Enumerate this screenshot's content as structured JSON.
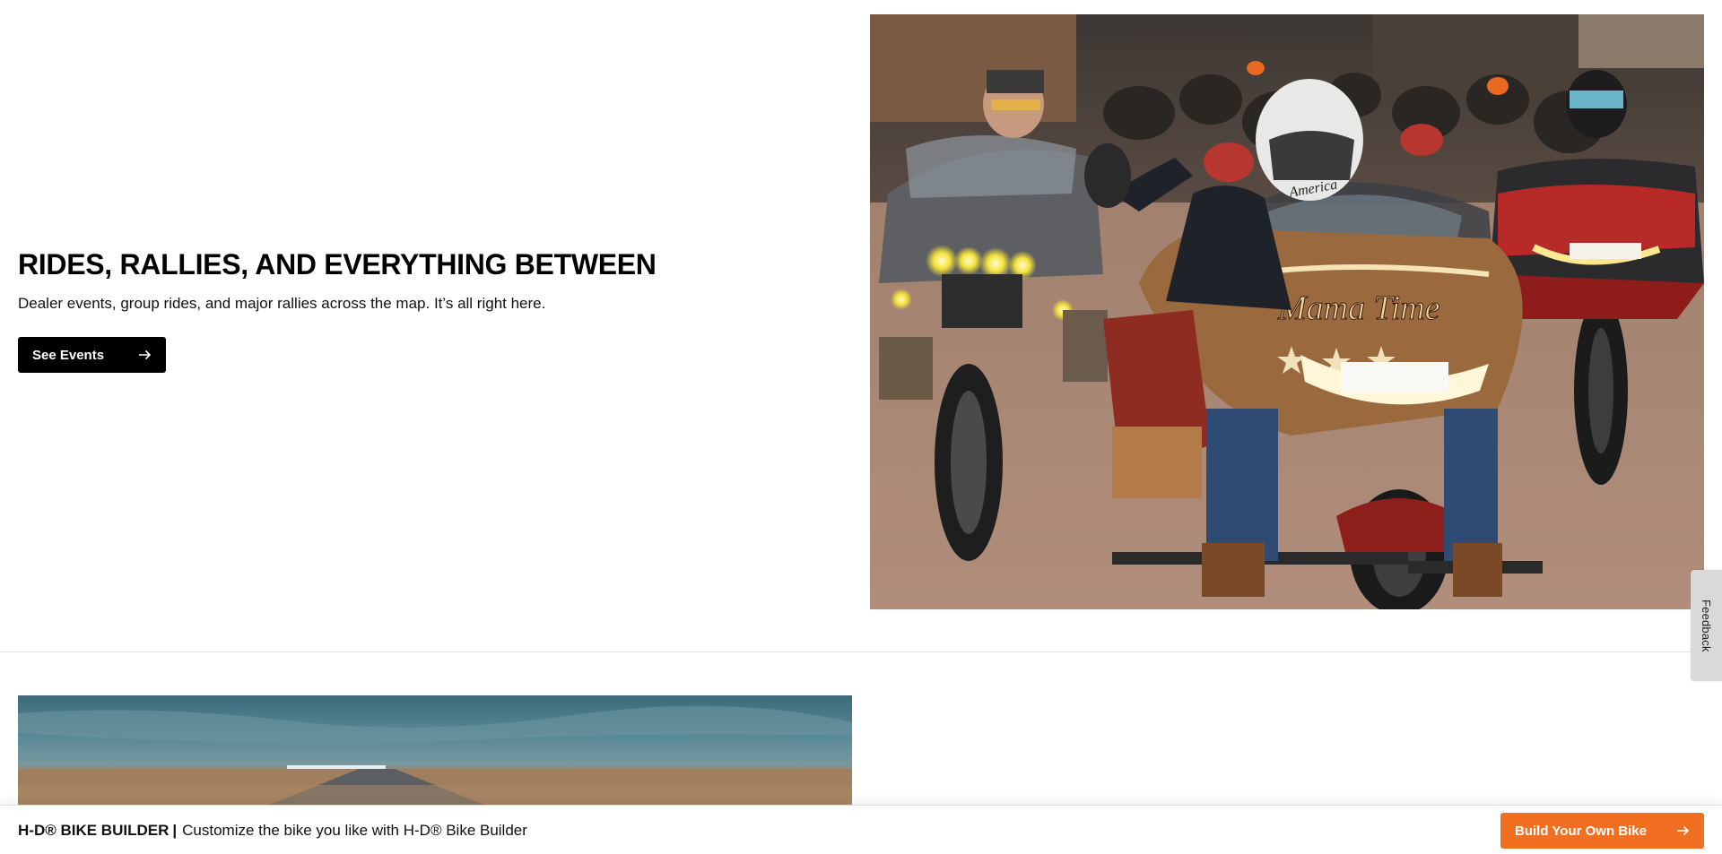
{
  "events": {
    "heading": "RIDES, RALLIES, AND EVERYTHING BETWEEN",
    "subheading": "Dealer events, group rides, and major rallies across the map. It’s all right here.",
    "cta_label": "See Events"
  },
  "feedback": {
    "label": "Feedback"
  },
  "builder_bar": {
    "brand": "H-D® BIKE BUILDER",
    "separator": "|",
    "tagline": "Customize the bike you like with H-D® Bike Builder",
    "cta_label": "Build Your Own Bike"
  },
  "photo_motorcycle": {
    "visible_text": [
      "America",
      "Mama Time"
    ]
  },
  "colors": {
    "primary_button": "#000000",
    "accent_button": "#f26f21",
    "feedback_tab": "#d9d9d9",
    "divider": "#e2e2e2"
  },
  "icons": {
    "cta_arrow": "arrow-right-icon"
  }
}
